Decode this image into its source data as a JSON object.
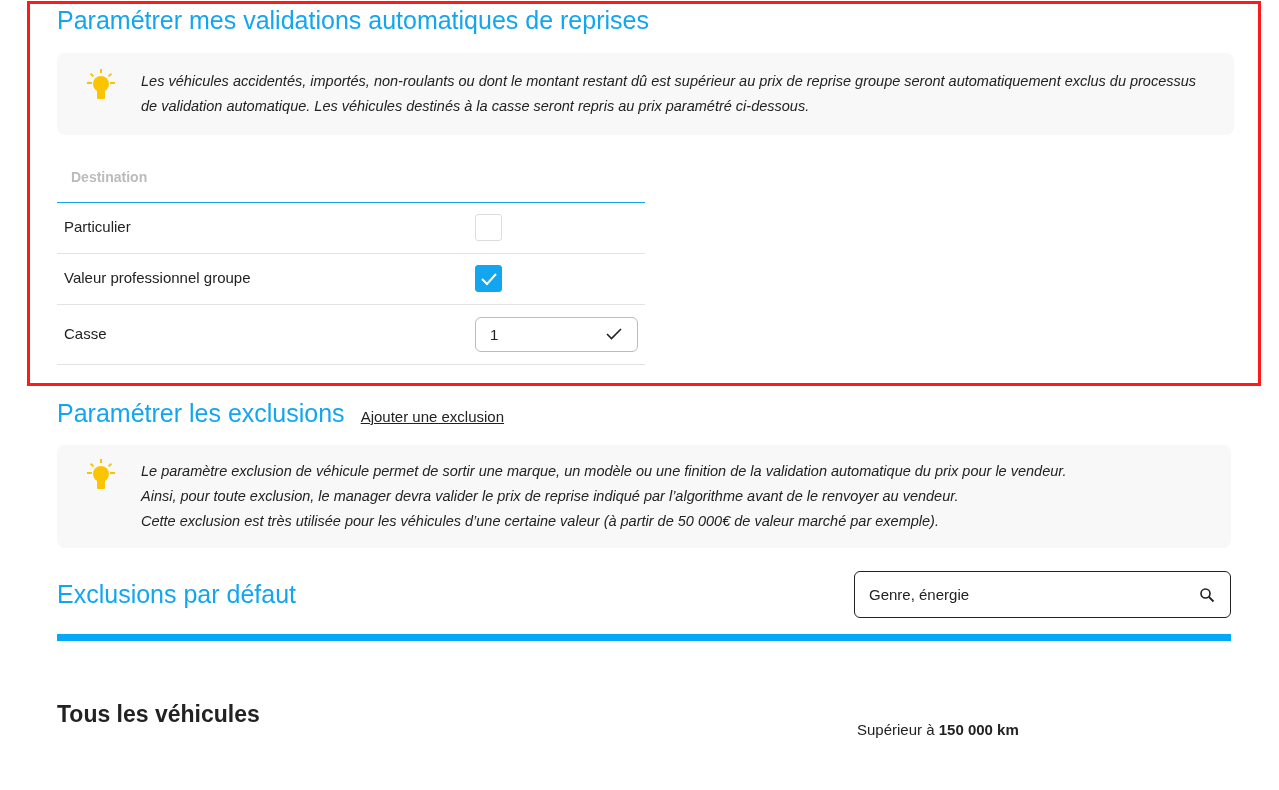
{
  "validation_section": {
    "title": "Paramétrer mes validations automatiques de reprises",
    "highlighted": true,
    "info": {
      "lines": [
        "Les véhicules accidentés, importés, non-roulants ou dont le montant restant dû est supérieur au prix de reprise groupe seront automatiquement exclus du processus de validation automatique. Les véhicules destinés à la casse seront repris au prix paramétré ci-dessous."
      ]
    },
    "table": {
      "column_1": "Destination",
      "rows": [
        {
          "label": "Particulier",
          "kind": "checkbox",
          "checked": false
        },
        {
          "label": "Valeur professionnel groupe",
          "kind": "checkbox",
          "checked": true
        },
        {
          "label": "Casse",
          "kind": "input",
          "value": "1"
        }
      ]
    }
  },
  "exclusions_section": {
    "title": "Paramétrer les exclusions",
    "link": "Ajouter une exclusion",
    "info": {
      "lines": [
        "Le paramètre exclusion de véhicule permet de sortir une marque, un modèle ou une finition de la validation automatique du prix pour le vendeur.",
        "Ainsi, pour toute exclusion, le manager devra valider le prix de reprise indiqué par l’algorithme avant de le renvoyer au vendeur.",
        "Cette exclusion est très utilisée pour les véhicules d’une certaine valeur (à partir de 50 000€ de valeur marché par exemple)."
      ]
    }
  },
  "default_exclusions": {
    "title": "Exclusions par défaut",
    "search": {
      "placeholder": "Genre, énergie"
    },
    "groups": [
      {
        "title": "Tous les véhicules",
        "rule": "Supérieur à **150 000 km**"
      }
    ]
  }
}
